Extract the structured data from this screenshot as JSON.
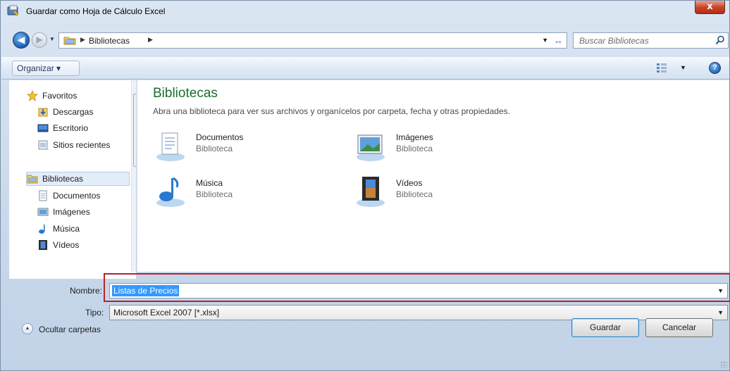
{
  "window": {
    "title": "Guardar como Hoja de Cálculo Excel",
    "close_label": "x"
  },
  "address": {
    "breadcrumb": "Bibliotecas",
    "search_placeholder": "Buscar Bibliotecas"
  },
  "toolbar": {
    "organize_label": "Organizar ▾",
    "help_label": "?"
  },
  "sidebar": {
    "groups": [
      {
        "label": "Favoritos",
        "icon": "star-icon",
        "items": [
          {
            "label": "Descargas",
            "icon": "downloads-icon"
          },
          {
            "label": "Escritorio",
            "icon": "desktop-icon"
          },
          {
            "label": "Sitios recientes",
            "icon": "recent-places-icon"
          }
        ]
      },
      {
        "label": "Bibliotecas",
        "icon": "libraries-icon",
        "selected": true,
        "items": [
          {
            "label": "Documentos",
            "icon": "documents-icon"
          },
          {
            "label": "Imágenes",
            "icon": "pictures-icon"
          },
          {
            "label": "Música",
            "icon": "music-icon"
          },
          {
            "label": "Vídeos",
            "icon": "videos-icon"
          }
        ]
      }
    ]
  },
  "content": {
    "heading": "Bibliotecas",
    "subtitle": "Abra una biblioteca para ver sus archivos y organícelos por carpeta, fecha y otras propiedades.",
    "libraries": [
      {
        "name": "Documentos",
        "type": "Biblioteca",
        "icon": "documents-library-icon"
      },
      {
        "name": "Imágenes",
        "type": "Biblioteca",
        "icon": "pictures-library-icon"
      },
      {
        "name": "Música",
        "type": "Biblioteca",
        "icon": "music-library-icon"
      },
      {
        "name": "Vídeos",
        "type": "Biblioteca",
        "icon": "videos-library-icon"
      }
    ]
  },
  "form": {
    "name_label": "Nombre:",
    "name_value": "Listas de Precios",
    "type_label": "Tipo:",
    "type_value": "Microsoft Excel 2007 [*.xlsx]"
  },
  "footer": {
    "hide_folders_label": "Ocultar carpetas",
    "save_label": "Guardar",
    "cancel_label": "Cancelar"
  },
  "colors": {
    "accent_heading": "#1b6c2f",
    "selection": "#3399ff",
    "highlight_border": "#b8232a"
  }
}
